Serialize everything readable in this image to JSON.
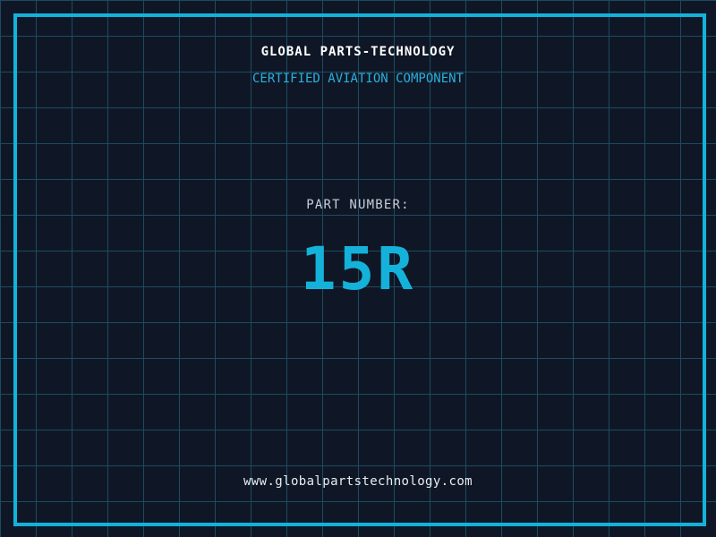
{
  "label": {
    "title": "GLOBAL PARTS-TECHNOLOGY",
    "subtitle": "CERTIFIED AVIATION COMPONENT",
    "part_number_label": "PART NUMBER:",
    "part_number": "15R",
    "website": "www.globalpartstechnology.com"
  },
  "colors": {
    "background": "#0f1726",
    "grid_line": "#1d4b61",
    "accent_cyan": "#14b2da",
    "subtitle_cyan": "#2ab0dc",
    "part_label_gray": "#c7cfdb",
    "title_white": "#ffffff",
    "website_white": "#e9edf2"
  }
}
